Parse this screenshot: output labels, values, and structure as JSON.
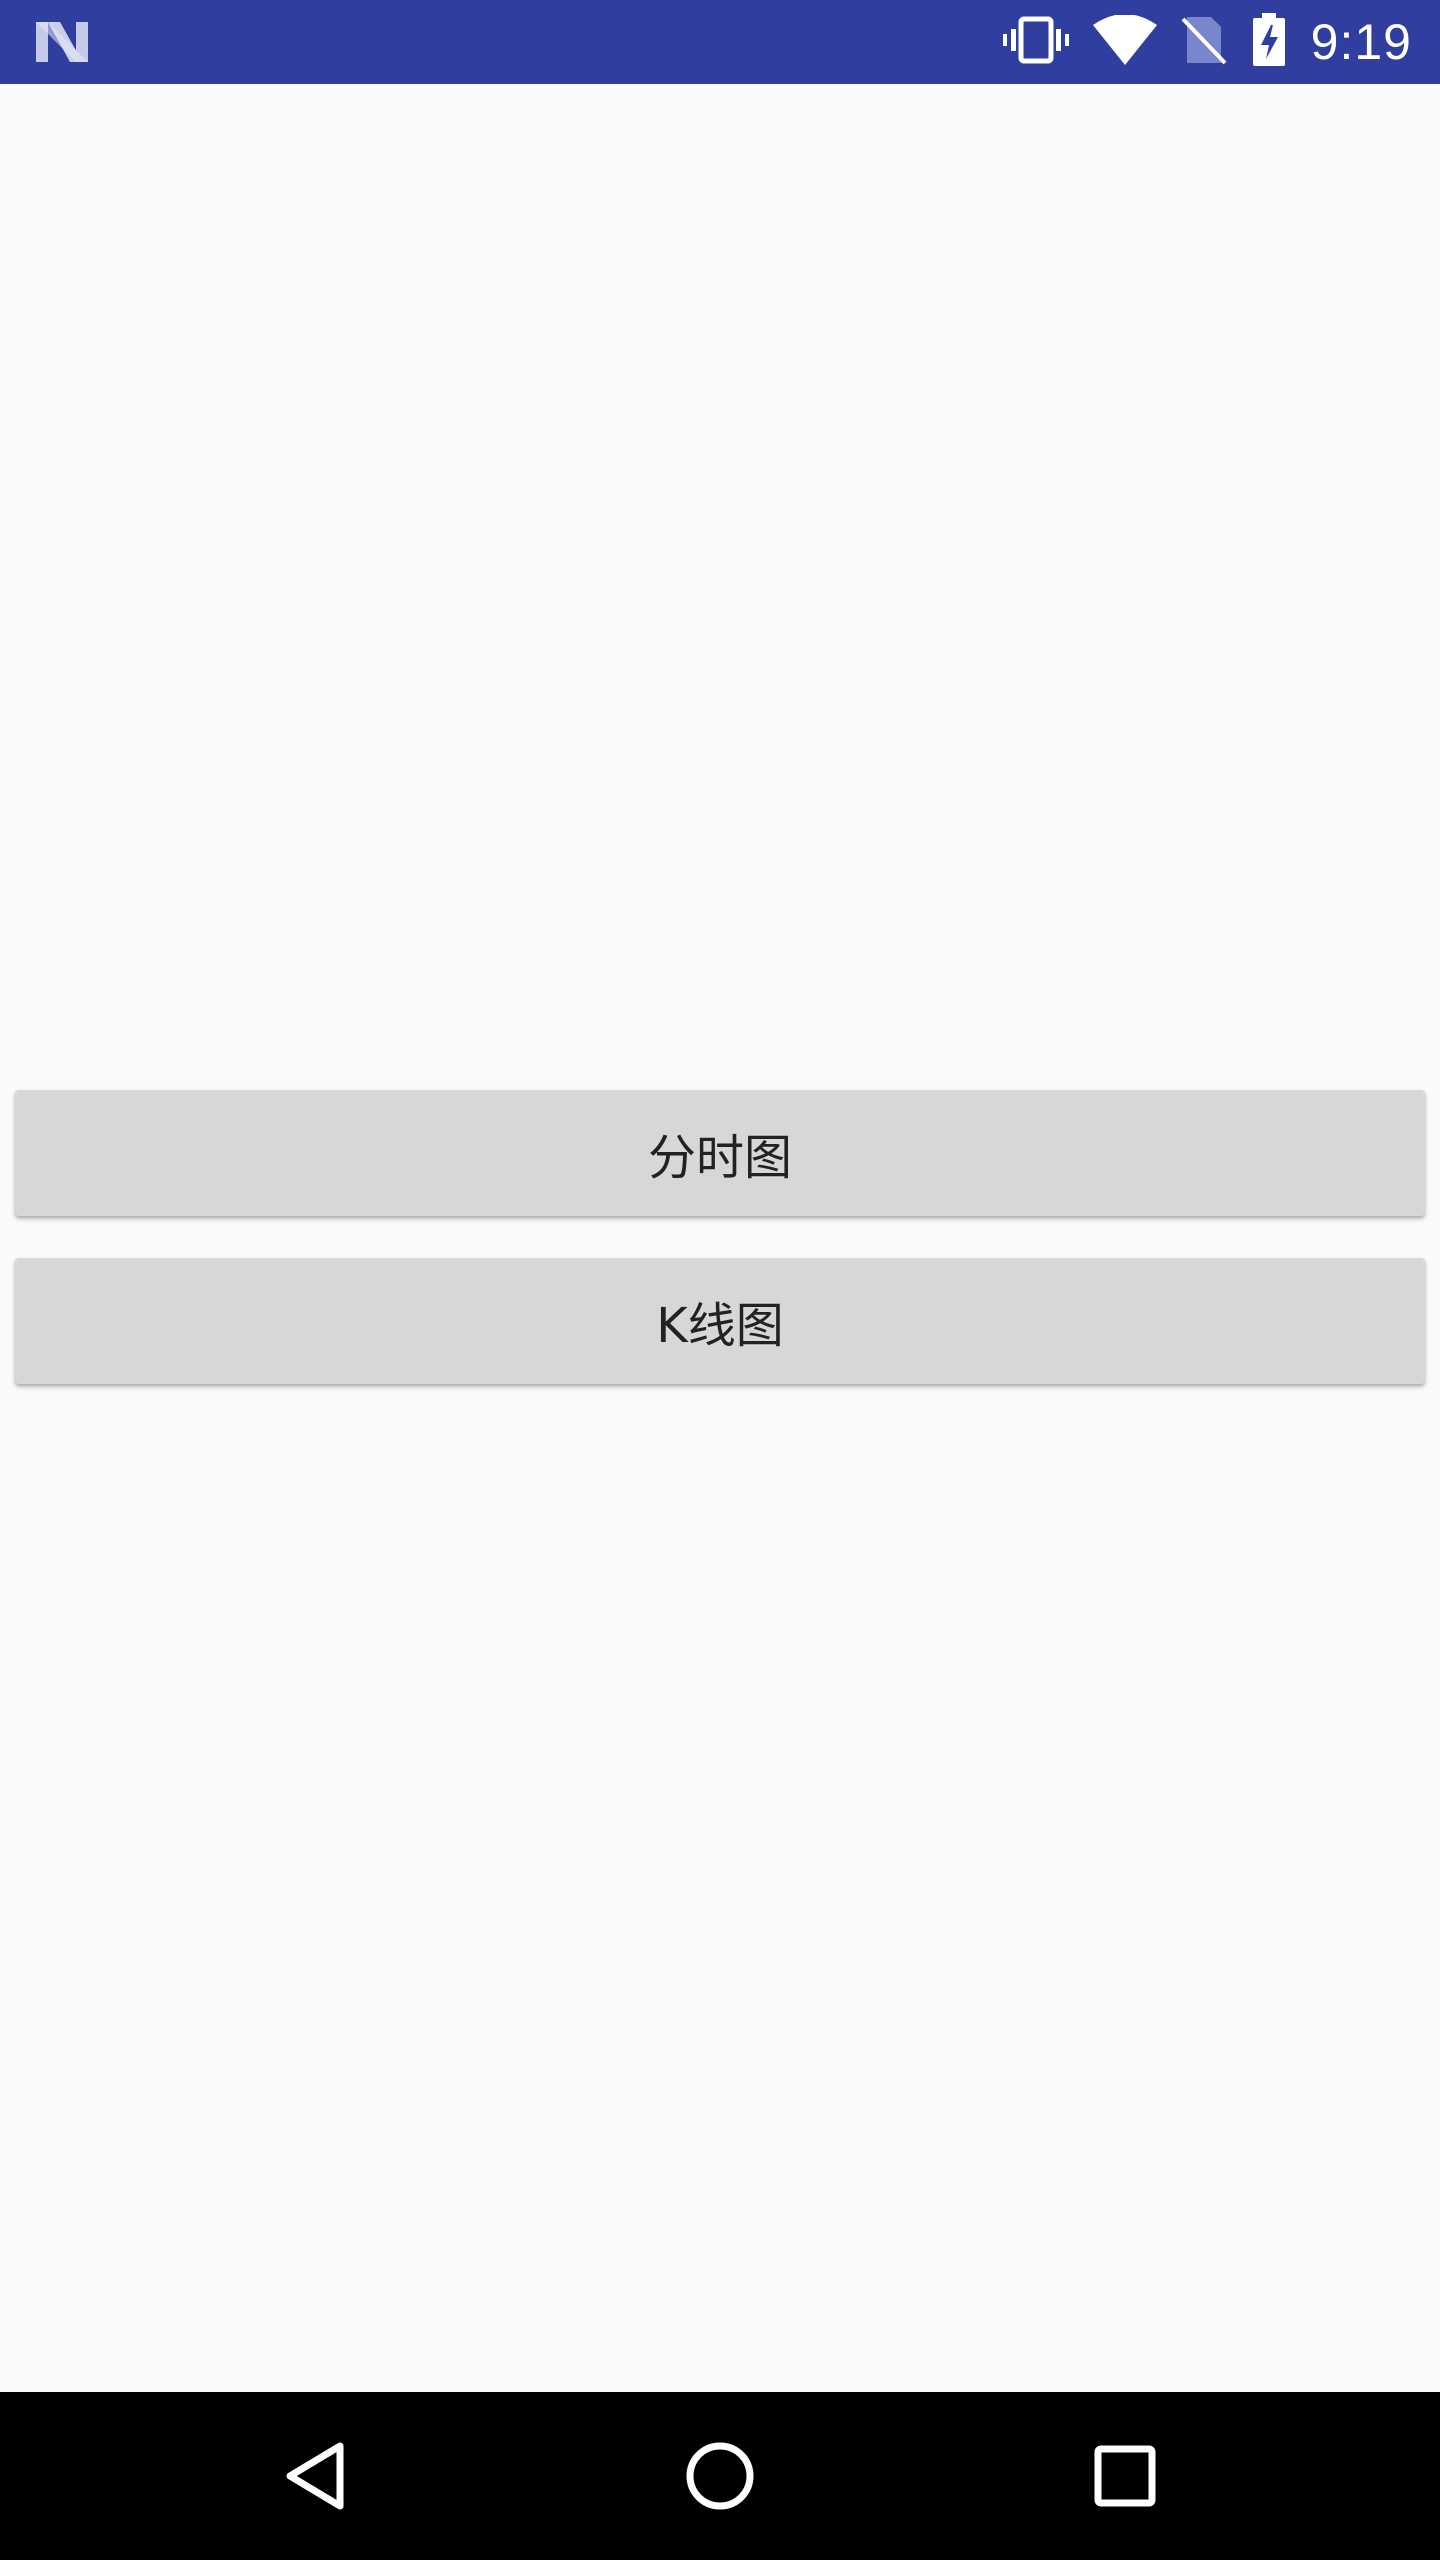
{
  "status_bar": {
    "time": "9:19",
    "icons": [
      "android-n-logo-icon",
      "vibrate-icon",
      "wifi-icon",
      "no-sim-icon",
      "battery-charging-icon"
    ],
    "background_color": "#303f9f"
  },
  "main": {
    "buttons": [
      {
        "label": "分时图"
      },
      {
        "label": "K线图"
      }
    ],
    "background_color": "#fafafa",
    "button_color": "#d6d7d7"
  },
  "nav_bar": {
    "icons": [
      "back-icon",
      "home-icon",
      "recent-apps-icon"
    ],
    "background_color": "#000000"
  }
}
